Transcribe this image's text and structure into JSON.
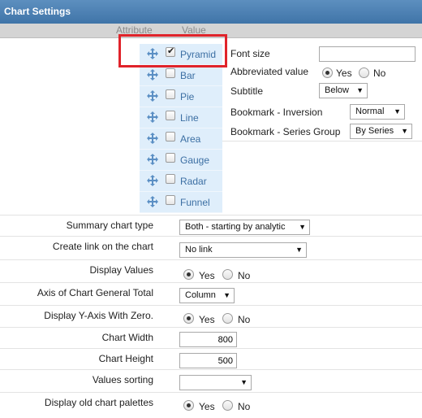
{
  "window": {
    "title": "Chart Settings"
  },
  "columns": {
    "attribute": "Attribute",
    "value": "Value"
  },
  "chart_types": [
    {
      "label": "Pyramid",
      "checked": true
    },
    {
      "label": "Bar",
      "checked": false
    },
    {
      "label": "Pie",
      "checked": false
    },
    {
      "label": "Line",
      "checked": false
    },
    {
      "label": "Area",
      "checked": false
    },
    {
      "label": "Gauge",
      "checked": false
    },
    {
      "label": "Radar",
      "checked": false
    },
    {
      "label": "Funnel",
      "checked": false
    }
  ],
  "chart_options": {
    "font_size": {
      "label": "Font size",
      "value": ""
    },
    "abbreviated_value": {
      "label": "Abbreviated value",
      "yes": "Yes",
      "no": "No",
      "selected": "Yes"
    },
    "subtitle": {
      "label": "Subtitle",
      "value": "Below"
    },
    "bookmark_inversion": {
      "label": "Bookmark - Inversion",
      "value": "Normal"
    },
    "bookmark_series_group": {
      "label": "Bookmark - Series Group",
      "value": "By Series"
    }
  },
  "settings": {
    "summary_chart_type": {
      "label": "Summary chart type",
      "value": "Both - starting by analytic"
    },
    "create_link": {
      "label": "Create link on the chart",
      "value": "No link"
    },
    "display_values": {
      "label": "Display Values",
      "yes": "Yes",
      "no": "No",
      "selected": "Yes"
    },
    "axis_general_total": {
      "label": "Axis of Chart General Total",
      "value": "Column"
    },
    "y_axis_zero": {
      "label": "Display Y-Axis With Zero.",
      "yes": "Yes",
      "no": "No",
      "selected": "Yes"
    },
    "chart_width": {
      "label": "Chart Width",
      "value": "800"
    },
    "chart_height": {
      "label": "Chart Height",
      "value": "500"
    },
    "values_sorting": {
      "label": "Values sorting",
      "value": ""
    },
    "old_palettes": {
      "label": "Display old chart palettes",
      "yes": "Yes",
      "no": "No",
      "selected": "Yes"
    }
  },
  "icons": {
    "drag": "move-icon",
    "dropdown": "dropdown-arrow-icon"
  },
  "colors": {
    "title_bar": "#4a7db1",
    "chart_list_bg": "#dfeefb",
    "chart_label": "#3c6fa3",
    "highlight": "#e0232a"
  }
}
